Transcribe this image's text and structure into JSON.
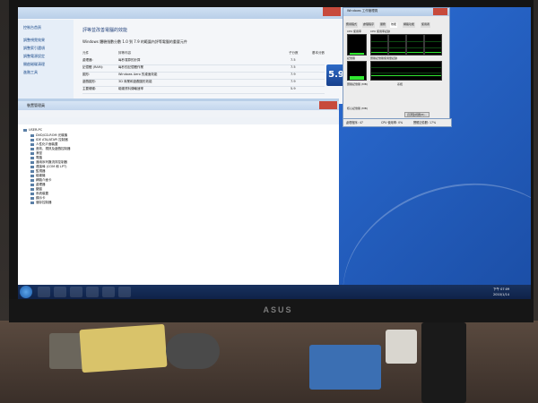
{
  "monitor": {
    "brand": "ASUS"
  },
  "system_properties": {
    "nav_items": [
      "控制台首頁",
      "調整視覺效果",
      "調整索引選項",
      "調整電源設定",
      "開啟磁碟清理",
      "進階工具"
    ],
    "title": "評等並改善電腦的效能",
    "description": "Windows 體驗指數分數 1.0 到 7.9 的範圍內評等電腦的重要元件",
    "col_component": "元件",
    "col_rating": "評等內容",
    "col_subscore": "子分數",
    "col_base": "基本分數",
    "rows": [
      {
        "component": "處理器:",
        "detail": "每秒運算的計算",
        "score": "7.5"
      },
      {
        "component": "記憶體 (RAM):",
        "detail": "每秒的記憶體作業",
        "score": "7.5"
      },
      {
        "component": "圖形:",
        "detail": "Windows Aero 的桌面效能",
        "score": "7.9"
      },
      {
        "component": "遊戲圖形:",
        "detail": "3D 商業和遊戲圖形效能",
        "score": "7.9"
      },
      {
        "component": "主要硬碟:",
        "detail": "磁碟資料傳輸速率",
        "score": "5.9"
      }
    ],
    "base_score": "5.9"
  },
  "device_manager": {
    "title": "裝置管理員",
    "tree": [
      "USER-PC",
      "DVD/CD-ROM 光碟機",
      "IDE ATA/ATAPI 控制器",
      "人性化介面裝置",
      "音效、視訊及遊戲控制器",
      "滑鼠",
      "電腦",
      "通用序列匯流排控制器",
      "連接埠 (COM 和 LPT)",
      "監視器",
      "磁碟機",
      "網路介面卡",
      "處理器",
      "鍵盤",
      "系統裝置",
      "顯示卡",
      "儲存控制器"
    ]
  },
  "task_manager": {
    "title": "Windows 工作管理員",
    "tabs": [
      "應用程式",
      "處理程序",
      "服務",
      "效能",
      "網路功能",
      "使用者"
    ],
    "cpu_usage_label": "CPU 使用率",
    "cpu_history_label": "CPU 使用率記錄",
    "memory_label": "記憶體",
    "memory_history_label": "實體記憶體使用量記錄",
    "physical_memory_label": "實體記憶體 (MB)",
    "kernel_memory_label": "核心記憶體 (MB)",
    "system_label": "系統",
    "resource_monitor_button": "資源監視器(R)...",
    "status_processes": "處理程序: 47",
    "status_cpu": "CPU 使用率: 0%",
    "status_memory": "實體記憶體: 17%"
  },
  "taskbar": {
    "time": "下午 07:09",
    "date": "2010/1/14"
  },
  "colors": {
    "desktop": "#2a6ad0",
    "graph_green": "#30e830",
    "taskbar": "#0f2248"
  }
}
